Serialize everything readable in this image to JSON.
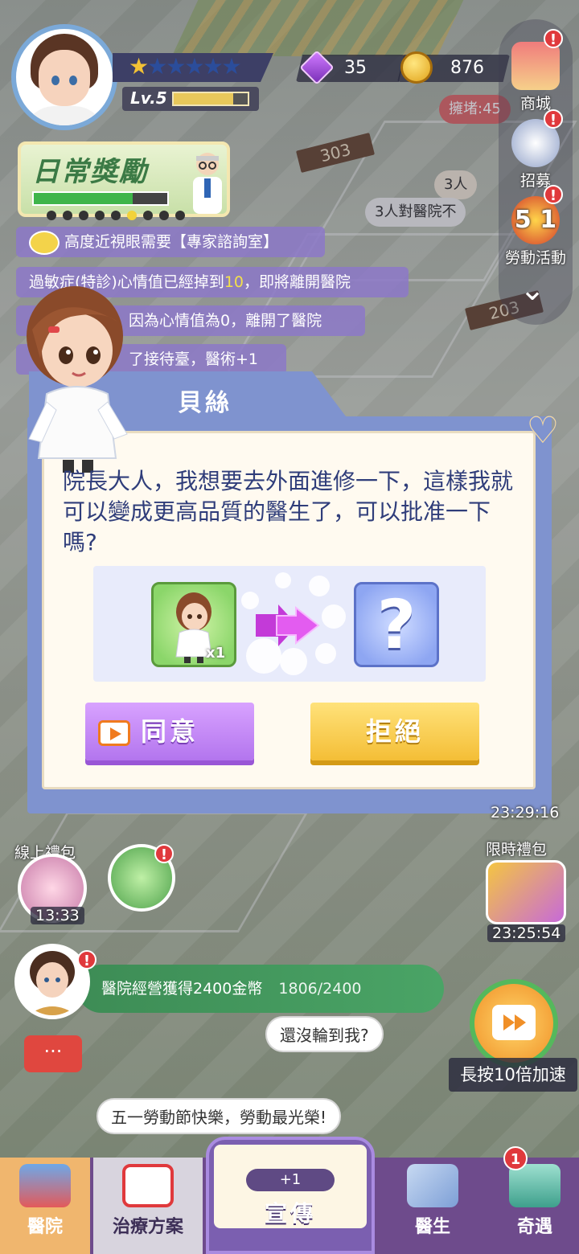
{
  "player": {
    "level_label": "Lv.5",
    "stars_total": 6,
    "stars_filled": 1,
    "level_progress": 0.8,
    "gems": "35",
    "coins": "876"
  },
  "sidebar": {
    "shop_label": "商城",
    "recruit_label": "招募",
    "labor_event_label": "勞動活動",
    "labor_event_badge_text": "5 1"
  },
  "daily_reward": {
    "title": "日常獎勵",
    "progress": 0.74,
    "dots_total": 9,
    "dots_on_index": 5
  },
  "notifications": [
    {
      "text": "高度近視眼需要【專家諮詢室】"
    },
    {
      "prefix": "過敏症(特診)心情值已經掉到",
      "value": "10",
      "suffix": "，即將離開醫院"
    },
    {
      "text": "因為心情值為0，離開了醫院"
    },
    {
      "text": "了接待臺，醫術+1"
    }
  ],
  "world_labels": {
    "room_303": "303",
    "room_203": "203",
    "crowd": "擁堵:45",
    "people_count": "3人",
    "hospital_complaint": "3人對醫院不"
  },
  "dialog": {
    "title": "貝絲",
    "message": "院長大人，我想要去外面進修一下，這樣我就可以變成更高品質的醫生了，可以批准一下嗎?",
    "current_card_count": "x1",
    "result_placeholder": "?",
    "agree_label": "同意",
    "refuse_label": "拒絕"
  },
  "hud": {
    "online_gift_label": "線上禮包",
    "online_gift_timer": "13:33",
    "limited_gift_label": "限時禮包",
    "limited_gift_timer": "23:25:54",
    "other_timer": "23:29:16",
    "task_text": "醫院經營獲得2400金幣",
    "task_progress": "1806/2400",
    "speed_label": "長按10倍加速",
    "speech_wait": "還沒輪到我?",
    "speech_labor": "五一勞動節快樂，勞動最光榮!",
    "chat_icon": "···"
  },
  "tabs": [
    {
      "label": "醫院"
    },
    {
      "label": "治療方案"
    },
    {
      "label": "宣傳",
      "reward": "+1"
    },
    {
      "label": "醫生"
    },
    {
      "label": "奇遇",
      "badge": "1"
    }
  ],
  "colors": {
    "dialog_frame": "#7f93cf",
    "dialog_text": "#2f3d7a",
    "agree": "#b375ee",
    "refuse": "#f4be36",
    "notification_bg": "#8c78c8",
    "highlight": "#f3e04a"
  }
}
